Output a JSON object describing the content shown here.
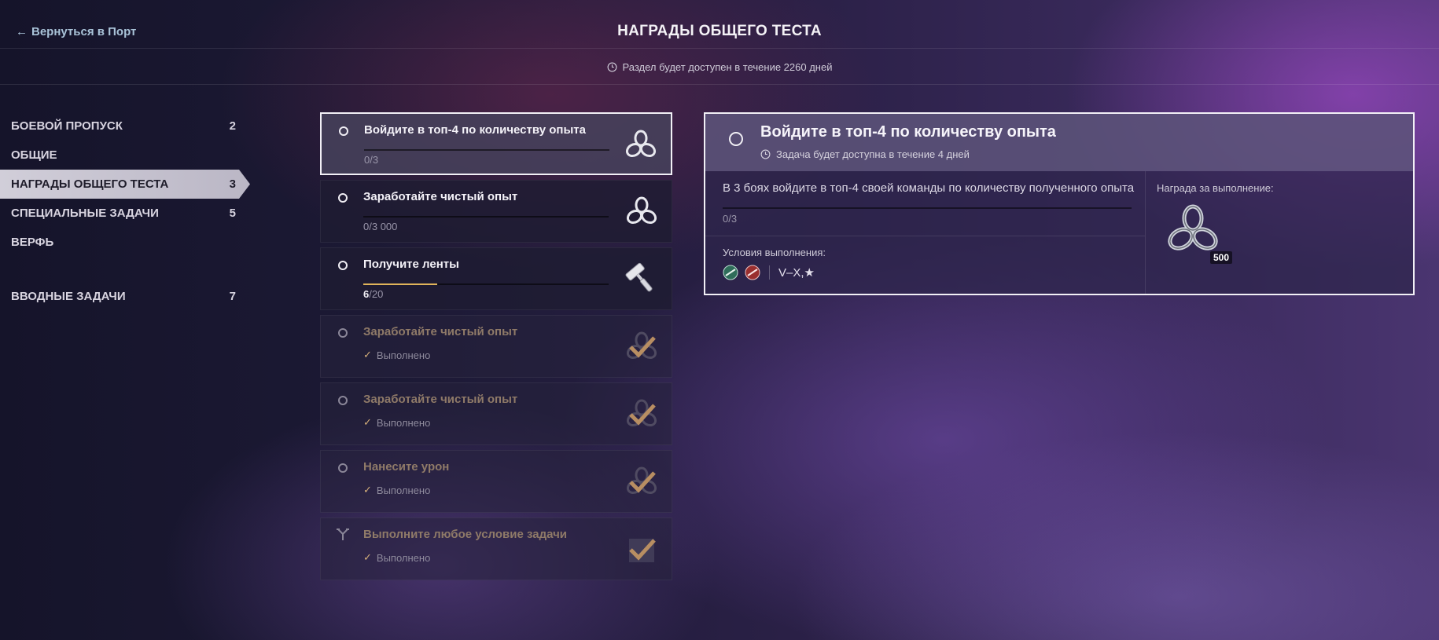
{
  "header": {
    "back_label": "Вернуться в Порт",
    "title": "НАГРАДЫ ОБЩЕГО ТЕСТА",
    "availability": "Раздел будет доступен в течение 2260 дней"
  },
  "sidebar": {
    "items": [
      {
        "label": "БОЕВОЙ ПРОПУСК",
        "count": "2"
      },
      {
        "label": "ОБЩИЕ",
        "count": ""
      },
      {
        "label": "НАГРАДЫ ОБЩЕГО ТЕСТА",
        "count": "3",
        "active": true
      },
      {
        "label": "СПЕЦИАЛЬНЫЕ ЗАДАЧИ",
        "count": "5"
      },
      {
        "label": "ВЕРФЬ",
        "count": ""
      },
      {
        "label": "ВВОДНЫЕ ЗАДАЧИ",
        "count": "7"
      }
    ]
  },
  "tasks": [
    {
      "title": "Войдите в топ-4 по количеству опыта",
      "progress_current": "0",
      "progress_total": "/3",
      "fill": 0,
      "icon": "recycle-token-icon",
      "state": "selected"
    },
    {
      "title": "Заработайте чистый опыт",
      "progress_current": "0",
      "progress_total": "/3 000",
      "fill": 0,
      "icon": "recycle-token-icon",
      "state": "active"
    },
    {
      "title": "Получите ленты",
      "progress_current": "6",
      "progress_total": "/20",
      "fill": 0.3,
      "icon": "paint-roller-icon",
      "state": "active"
    },
    {
      "title": "Заработайте чистый опыт",
      "status": "Выполнено",
      "icon": "completed-check-icon",
      "state": "done"
    },
    {
      "title": "Заработайте чистый опыт",
      "status": "Выполнено",
      "icon": "completed-check-icon",
      "state": "done"
    },
    {
      "title": "Нанесите урон",
      "status": "Выполнено",
      "icon": "completed-check-icon",
      "state": "done"
    },
    {
      "title": "Выполните любое условие задачи",
      "status": "Выполнено",
      "icon": "completed-check-icon",
      "state": "done"
    }
  ],
  "detail": {
    "title": "Войдите в топ-4 по количеству опыта",
    "availability": "Задача будет доступна в течение 4 дней",
    "description": "В 3 боях войдите в топ-4 своей команды по количеству полученного опыта",
    "progress": "0/3",
    "conditions_label": "Условия выполнения:",
    "tiers": "V–X,★",
    "reward_label": "Награда за выполнение:",
    "reward_amount": "500"
  },
  "colors": {
    "accent_progress": "#e0b45a",
    "completed_title": "#8f7a68",
    "back_link": "#a9c3d8"
  }
}
